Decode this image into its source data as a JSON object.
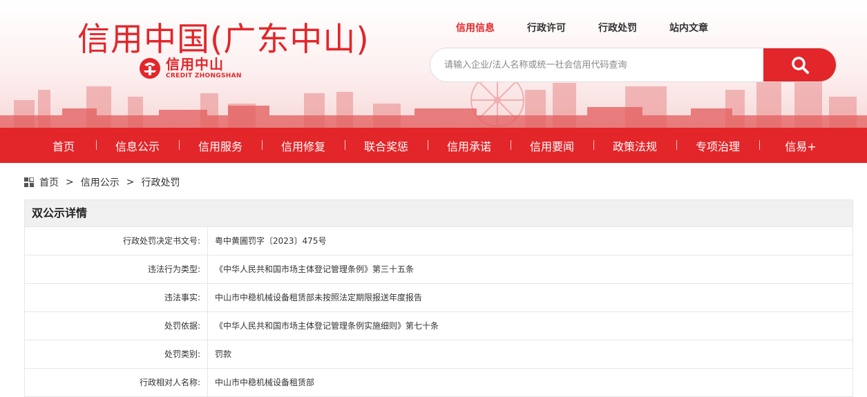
{
  "header": {
    "site_title": "信用中国(广东中山)",
    "logo_cn": "信用中山",
    "logo_en": "CREDIT ZHONGSHAN",
    "top_nav": [
      "信用信息",
      "行政许可",
      "行政处罚",
      "站内文章"
    ],
    "active_top_nav": "信用信息",
    "search_placeholder": "请输入企业/法人名称或统一社会信用代码查询",
    "brand_color": "#e2262a"
  },
  "main_nav": [
    "首页",
    "信息公示",
    "信用服务",
    "信用修复",
    "联合奖惩",
    "信用承诺",
    "信用要闻",
    "政策法规",
    "专项治理",
    "信易+"
  ],
  "breadcrumb": [
    "首页",
    "信用公示",
    "行政处罚"
  ],
  "detail": {
    "title": "双公示详情",
    "rows": [
      {
        "label": "行政处罚决定书文号:",
        "value": "粤中黄圃罚字〔2023〕475号"
      },
      {
        "label": "违法行为类型:",
        "value": "《中华人民共和国市场主体登记管理条例》第三十五条"
      },
      {
        "label": "违法事实:",
        "value": "中山市中稳机械设备租赁部未按照法定期限报送年度报告"
      },
      {
        "label": "处罚依据:",
        "value": "《中华人民共和国市场主体登记管理条例实施细则》第七十条"
      },
      {
        "label": "处罚类别:",
        "value": "罚款"
      },
      {
        "label": "行政相对人名称:",
        "value": "中山市中稳机械设备租赁部"
      }
    ]
  }
}
